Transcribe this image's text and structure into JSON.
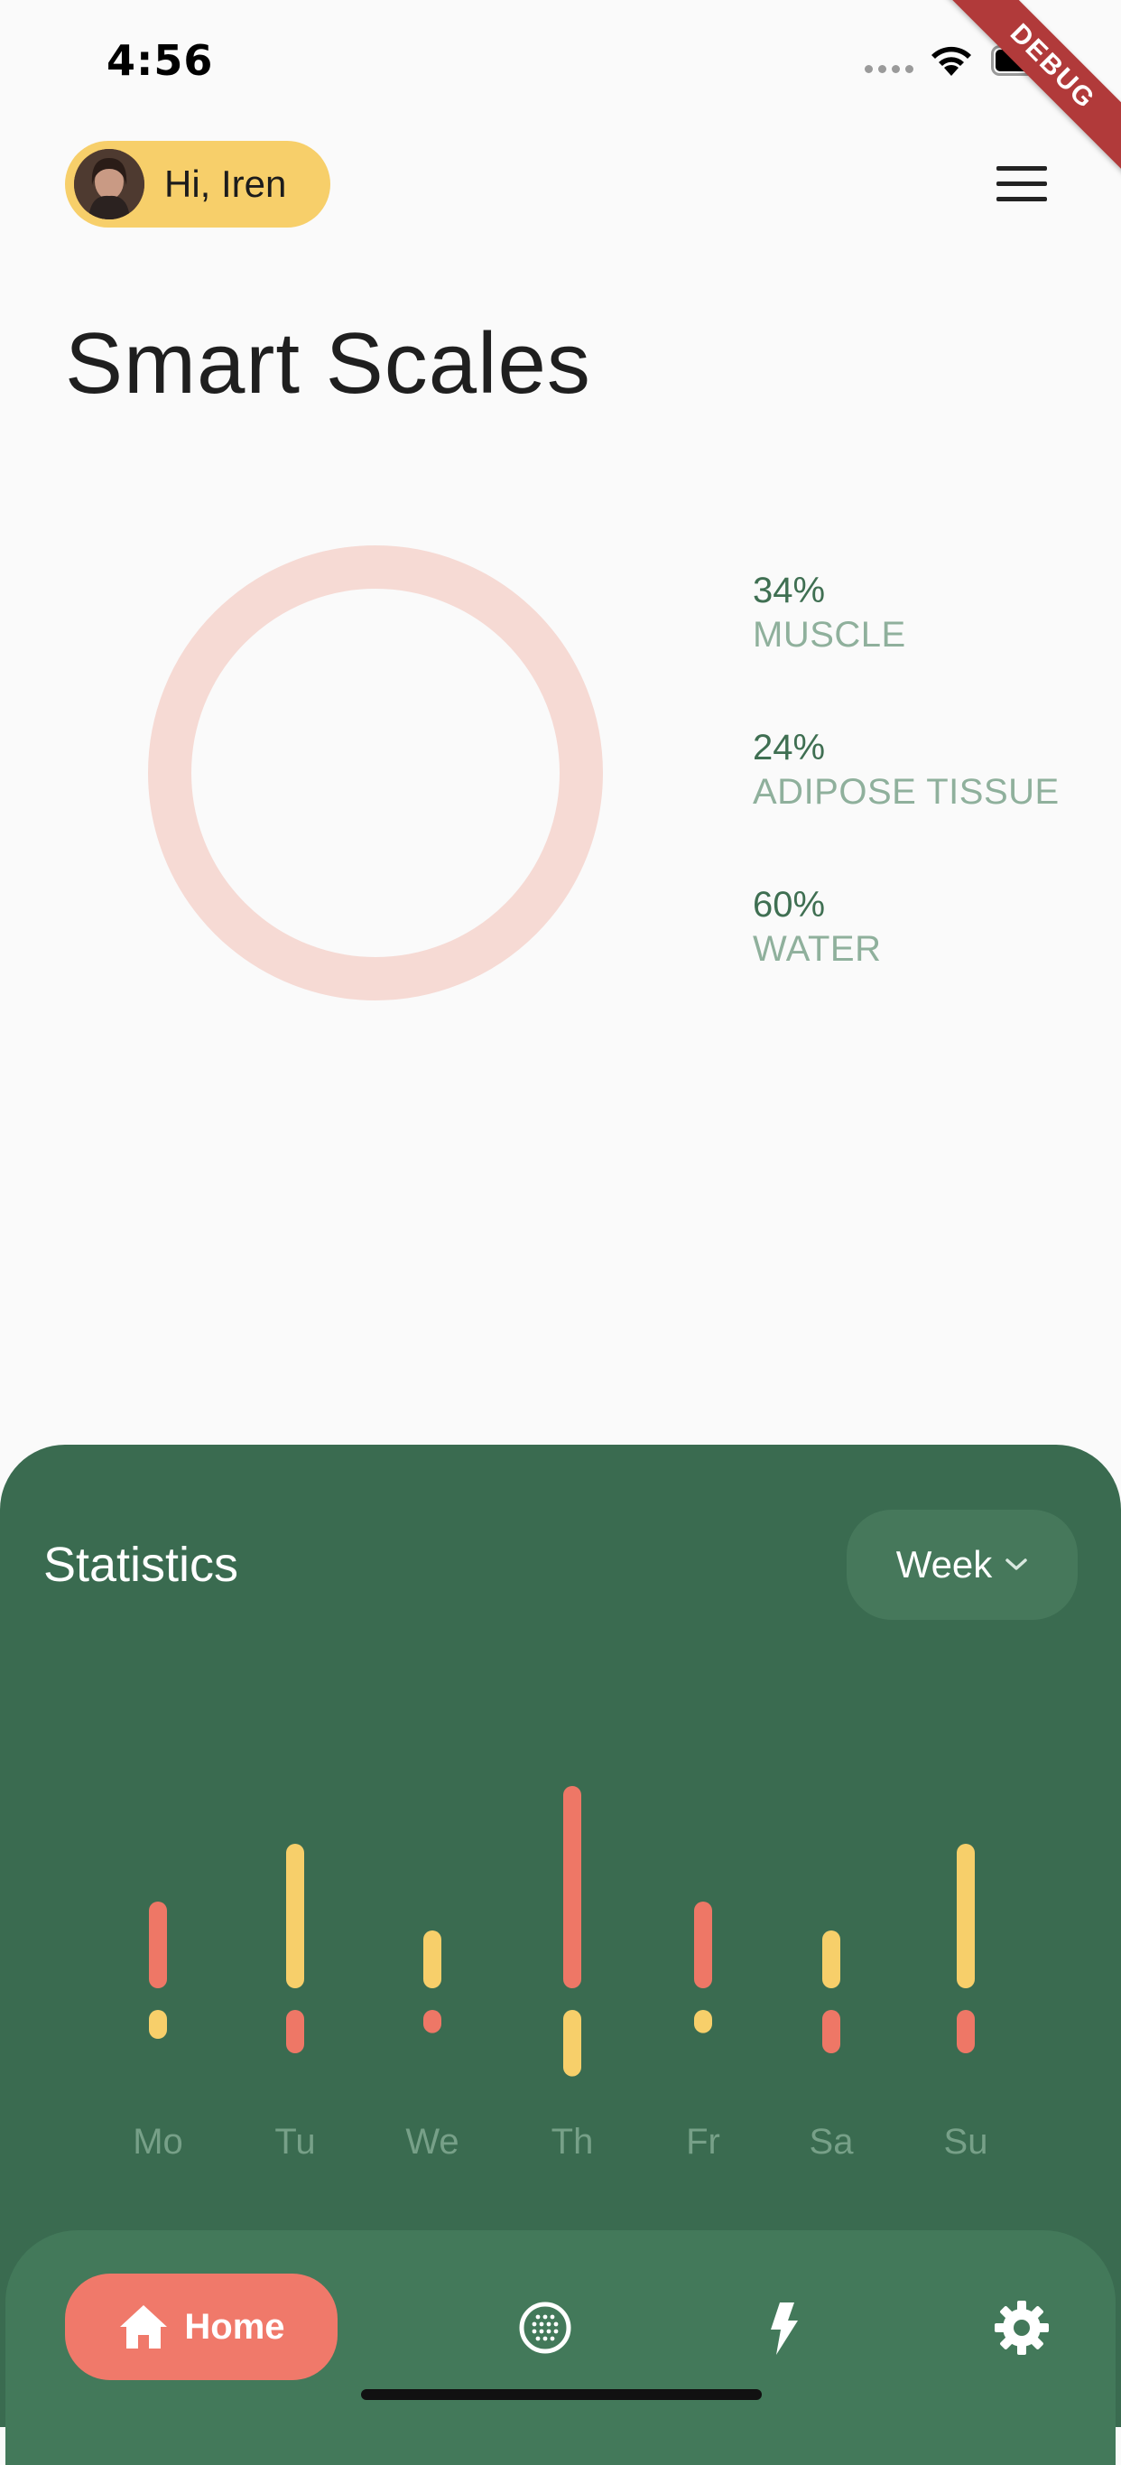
{
  "status_bar": {
    "time": "4:56"
  },
  "debug_banner": "DEBUG",
  "header": {
    "greeting": "Hi, Iren",
    "menu_icon": "hamburger-menu-icon"
  },
  "page_title": "Smart Scales",
  "body_composition": {
    "ring_color": "#f6dad4",
    "stats": [
      {
        "value": "34%",
        "label": "MUSCLE"
      },
      {
        "value": "24%",
        "label": "ADIPOSE TISSUE"
      },
      {
        "value": "60%",
        "label": "WATER"
      }
    ]
  },
  "statistics": {
    "title": "Statistics",
    "period": "Week",
    "period_icon": "chevron-down-icon"
  },
  "chart_data": {
    "type": "bar",
    "categories": [
      "Mo",
      "Tu",
      "We",
      "Th",
      "Fr",
      "Sa",
      "Su"
    ],
    "colors": {
      "red": "#ee7766",
      "yellow": "#f7cf6a"
    },
    "upper_bars": [
      {
        "value": 3,
        "color": "red"
      },
      {
        "value": 5,
        "color": "yellow"
      },
      {
        "value": 2,
        "color": "yellow"
      },
      {
        "value": 7,
        "color": "red"
      },
      {
        "value": 3,
        "color": "red"
      },
      {
        "value": 2,
        "color": "yellow"
      },
      {
        "value": 5,
        "color": "yellow"
      }
    ],
    "lower_bars": [
      {
        "value": 1,
        "color": "yellow"
      },
      {
        "value": 1.5,
        "color": "red"
      },
      {
        "value": 0.8,
        "color": "red"
      },
      {
        "value": 2.3,
        "color": "yellow"
      },
      {
        "value": 0.8,
        "color": "yellow"
      },
      {
        "value": 1.5,
        "color": "red"
      },
      {
        "value": 1.5,
        "color": "red"
      }
    ]
  },
  "bottom_nav": {
    "home_label": "Home",
    "home_icon": "home-icon",
    "items": [
      "globe-icon",
      "lightning-icon",
      "gear-icon"
    ],
    "active_color": "#f0796a"
  }
}
